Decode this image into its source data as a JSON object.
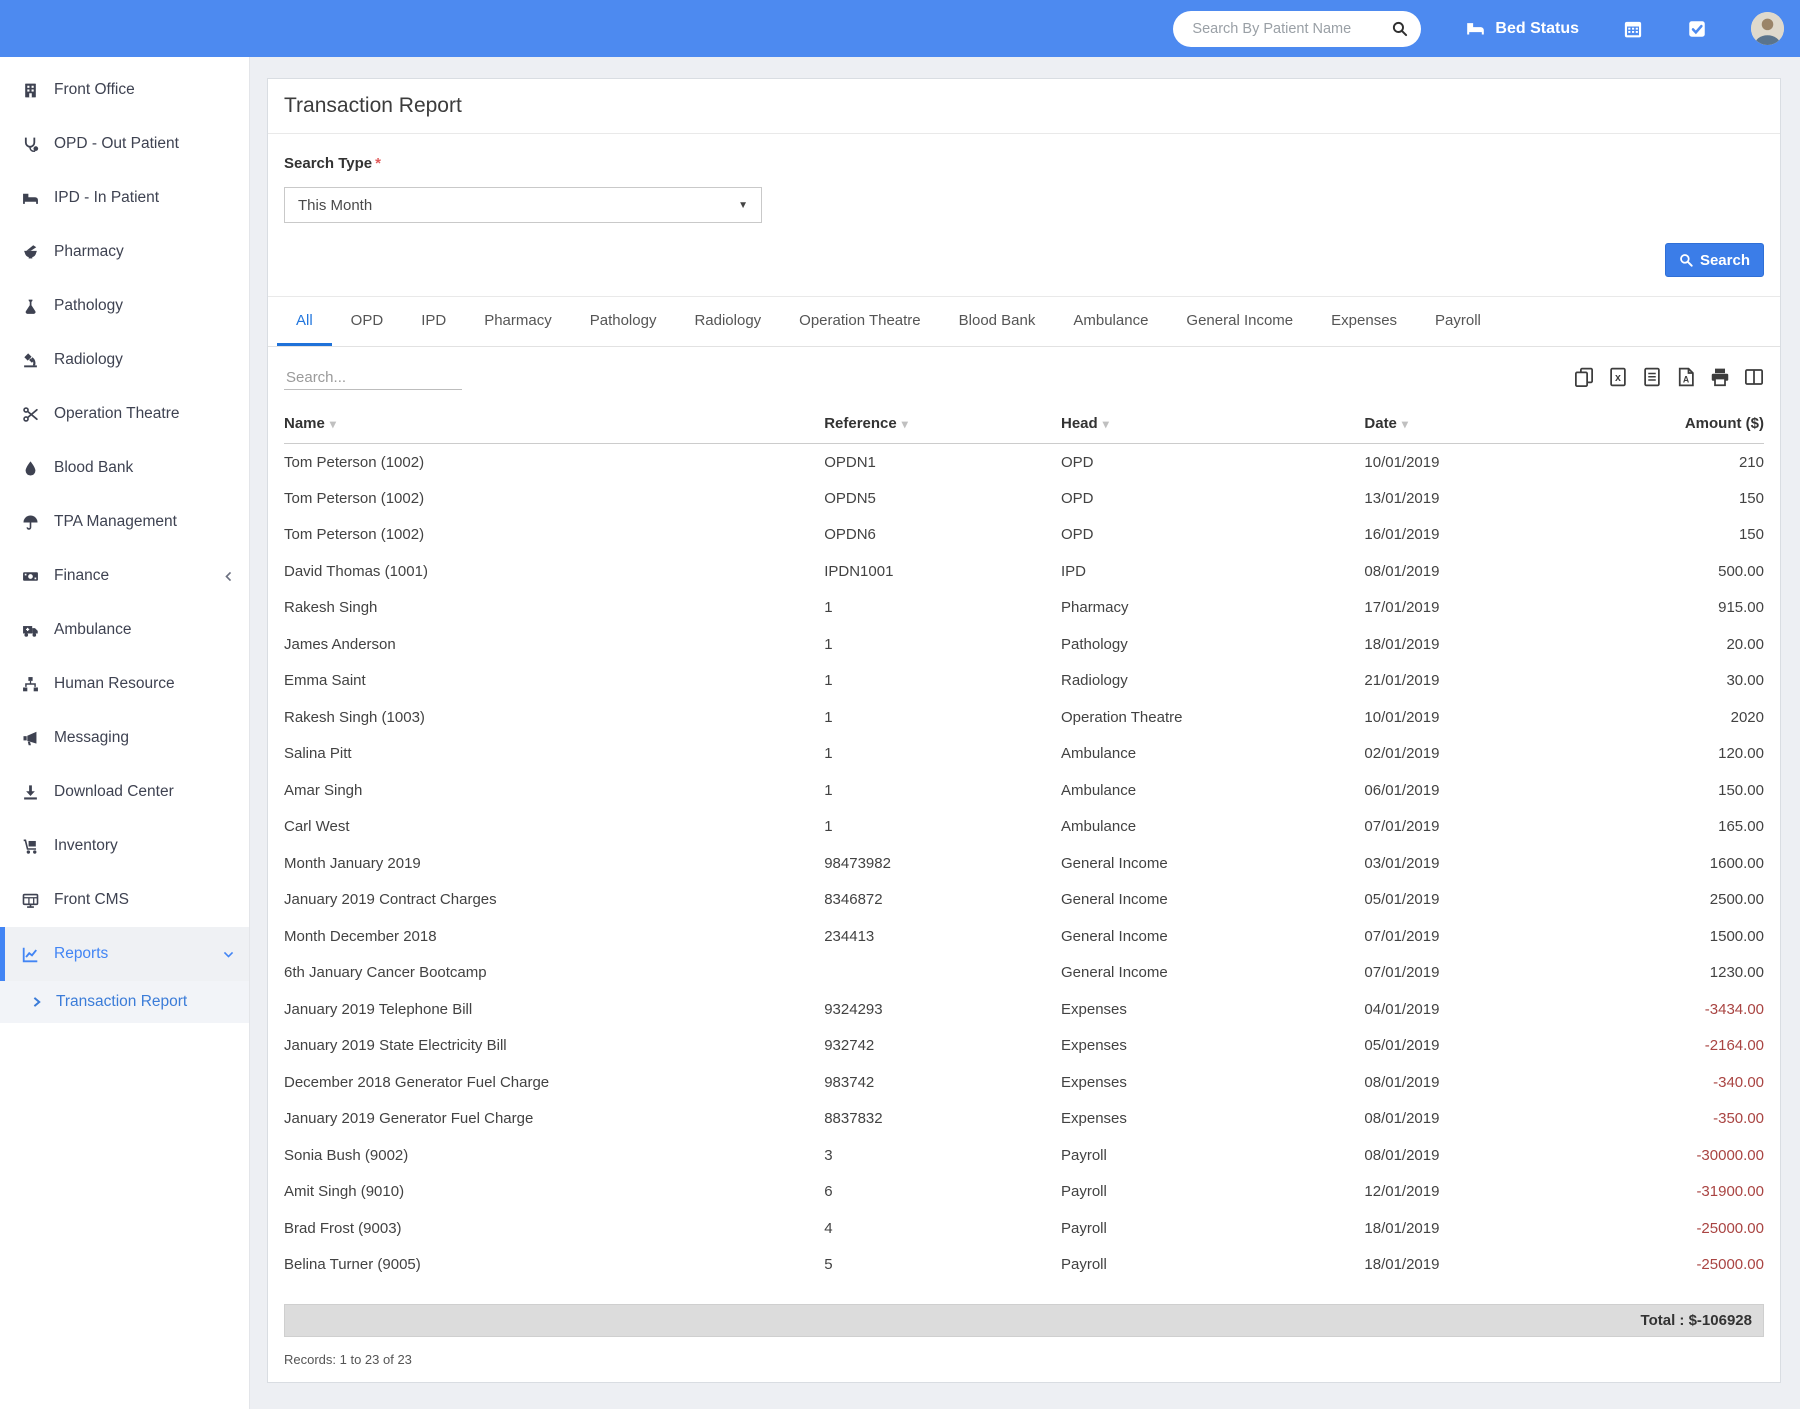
{
  "colors": {
    "header_blue": "#4d8af0",
    "sidebar_active_blue": "#4285f4",
    "active_tab_blue": "#2276dd",
    "button_blue": "#3b7de8",
    "negative_red": "#a94442",
    "total_bar_gray": "#dcdcdc"
  },
  "glyphs": {
    "sort_caret": "▾",
    "dropdown_caret": "▼"
  },
  "header": {
    "search_placeholder": "Search By Patient Name",
    "bed_status_label": "Bed Status",
    "icons": [
      "bed-icon",
      "calendar-icon",
      "tasks-icon",
      "avatar"
    ]
  },
  "sidebar": {
    "items": [
      {
        "label": "Front Office",
        "icon": "building-icon"
      },
      {
        "label": "OPD - Out Patient",
        "icon": "stethoscope-icon"
      },
      {
        "label": "IPD - In Patient",
        "icon": "bed-icon"
      },
      {
        "label": "Pharmacy",
        "icon": "mortar-icon"
      },
      {
        "label": "Pathology",
        "icon": "flask-icon"
      },
      {
        "label": "Radiology",
        "icon": "microscope-icon"
      },
      {
        "label": "Operation Theatre",
        "icon": "scissors-icon"
      },
      {
        "label": "Blood Bank",
        "icon": "droplet-icon"
      },
      {
        "label": "TPA Management",
        "icon": "umbrella-icon"
      },
      {
        "label": "Finance",
        "icon": "money-icon",
        "trailing": "chevron-left-icon"
      },
      {
        "label": "Ambulance",
        "icon": "ambulance-icon"
      },
      {
        "label": "Human Resource",
        "icon": "sitemap-icon"
      },
      {
        "label": "Messaging",
        "icon": "megaphone-icon"
      },
      {
        "label": "Download Center",
        "icon": "download-icon"
      },
      {
        "label": "Inventory",
        "icon": "trolley-icon"
      },
      {
        "label": "Front CMS",
        "icon": "monitor-icon"
      },
      {
        "label": "Reports",
        "icon": "chart-line-icon",
        "trailing": "chevron-down-icon",
        "active": true
      }
    ],
    "subitems": [
      {
        "label": "Transaction Report",
        "icon": "arrow-right-icon",
        "active": true
      }
    ]
  },
  "page": {
    "title": "Transaction Report",
    "search_type_label": "Search Type",
    "required_marker": "*",
    "search_type_value": "This Month",
    "search_button_label": "Search"
  },
  "tabs": {
    "active": "All",
    "items": [
      "All",
      "OPD",
      "IPD",
      "Pharmacy",
      "Pathology",
      "Radiology",
      "Operation Theatre",
      "Blood Bank",
      "Ambulance",
      "General Income",
      "Expenses",
      "Payroll"
    ]
  },
  "toolbar": {
    "search_placeholder": "Search...",
    "export_buttons": [
      "copy-icon",
      "excel-file-icon",
      "text-file-icon",
      "pdf-file-icon",
      "print-icon",
      "columns-icon"
    ]
  },
  "table": {
    "columns": [
      {
        "label": "Name",
        "sortable": true
      },
      {
        "label": "Reference",
        "sortable": true
      },
      {
        "label": "Head",
        "sortable": true
      },
      {
        "label": "Date",
        "sortable": true
      },
      {
        "label": "Amount ($)",
        "sortable": false,
        "numeric": true
      }
    ],
    "rows": [
      {
        "name": "Tom Peterson (1002)",
        "reference": "OPDN1",
        "head": "OPD",
        "date": "10/01/2019",
        "amount": "210"
      },
      {
        "name": "Tom Peterson (1002)",
        "reference": "OPDN5",
        "head": "OPD",
        "date": "13/01/2019",
        "amount": "150"
      },
      {
        "name": "Tom Peterson (1002)",
        "reference": "OPDN6",
        "head": "OPD",
        "date": "16/01/2019",
        "amount": "150"
      },
      {
        "name": "David Thomas (1001)",
        "reference": "IPDN1001",
        "head": "IPD",
        "date": "08/01/2019",
        "amount": "500.00"
      },
      {
        "name": "Rakesh Singh",
        "reference": "1",
        "head": "Pharmacy",
        "date": "17/01/2019",
        "amount": "915.00"
      },
      {
        "name": "James Anderson",
        "reference": "1",
        "head": "Pathology",
        "date": "18/01/2019",
        "amount": "20.00"
      },
      {
        "name": "Emma Saint",
        "reference": "1",
        "head": "Radiology",
        "date": "21/01/2019",
        "amount": "30.00"
      },
      {
        "name": "Rakesh Singh (1003)",
        "reference": "1",
        "head": "Operation Theatre",
        "date": "10/01/2019",
        "amount": "2020"
      },
      {
        "name": "Salina Pitt",
        "reference": "1",
        "head": "Ambulance",
        "date": "02/01/2019",
        "amount": "120.00"
      },
      {
        "name": "Amar Singh",
        "reference": "1",
        "head": "Ambulance",
        "date": "06/01/2019",
        "amount": "150.00"
      },
      {
        "name": "Carl West",
        "reference": "1",
        "head": "Ambulance",
        "date": "07/01/2019",
        "amount": "165.00"
      },
      {
        "name": "Month January 2019",
        "reference": "98473982",
        "head": "General Income",
        "date": "03/01/2019",
        "amount": "1600.00"
      },
      {
        "name": "January 2019 Contract Charges",
        "reference": "8346872",
        "head": "General Income",
        "date": "05/01/2019",
        "amount": "2500.00"
      },
      {
        "name": "Month December 2018",
        "reference": "234413",
        "head": "General Income",
        "date": "07/01/2019",
        "amount": "1500.00"
      },
      {
        "name": "6th January Cancer Bootcamp",
        "reference": "",
        "head": "General Income",
        "date": "07/01/2019",
        "amount": "1230.00"
      },
      {
        "name": "January 2019 Telephone Bill",
        "reference": "9324293",
        "head": "Expenses",
        "date": "04/01/2019",
        "amount": "-3434.00"
      },
      {
        "name": "January 2019 State Electricity Bill",
        "reference": "932742",
        "head": "Expenses",
        "date": "05/01/2019",
        "amount": "-2164.00"
      },
      {
        "name": "December 2018 Generator Fuel Charge",
        "reference": "983742",
        "head": "Expenses",
        "date": "08/01/2019",
        "amount": "-340.00"
      },
      {
        "name": "January 2019 Generator Fuel Charge",
        "reference": "8837832",
        "head": "Expenses",
        "date": "08/01/2019",
        "amount": "-350.00"
      },
      {
        "name": "Sonia Bush (9002)",
        "reference": "3",
        "head": "Payroll",
        "date": "08/01/2019",
        "amount": "-30000.00"
      },
      {
        "name": "Amit Singh (9010)",
        "reference": "6",
        "head": "Payroll",
        "date": "12/01/2019",
        "amount": "-31900.00"
      },
      {
        "name": "Brad Frost (9003)",
        "reference": "4",
        "head": "Payroll",
        "date": "18/01/2019",
        "amount": "-25000.00"
      },
      {
        "name": "Belina Turner (9005)",
        "reference": "5",
        "head": "Payroll",
        "date": "18/01/2019",
        "amount": "-25000.00"
      }
    ],
    "total_label": "Total : $-106928",
    "records_label": "Records: 1 to 23 of 23"
  }
}
